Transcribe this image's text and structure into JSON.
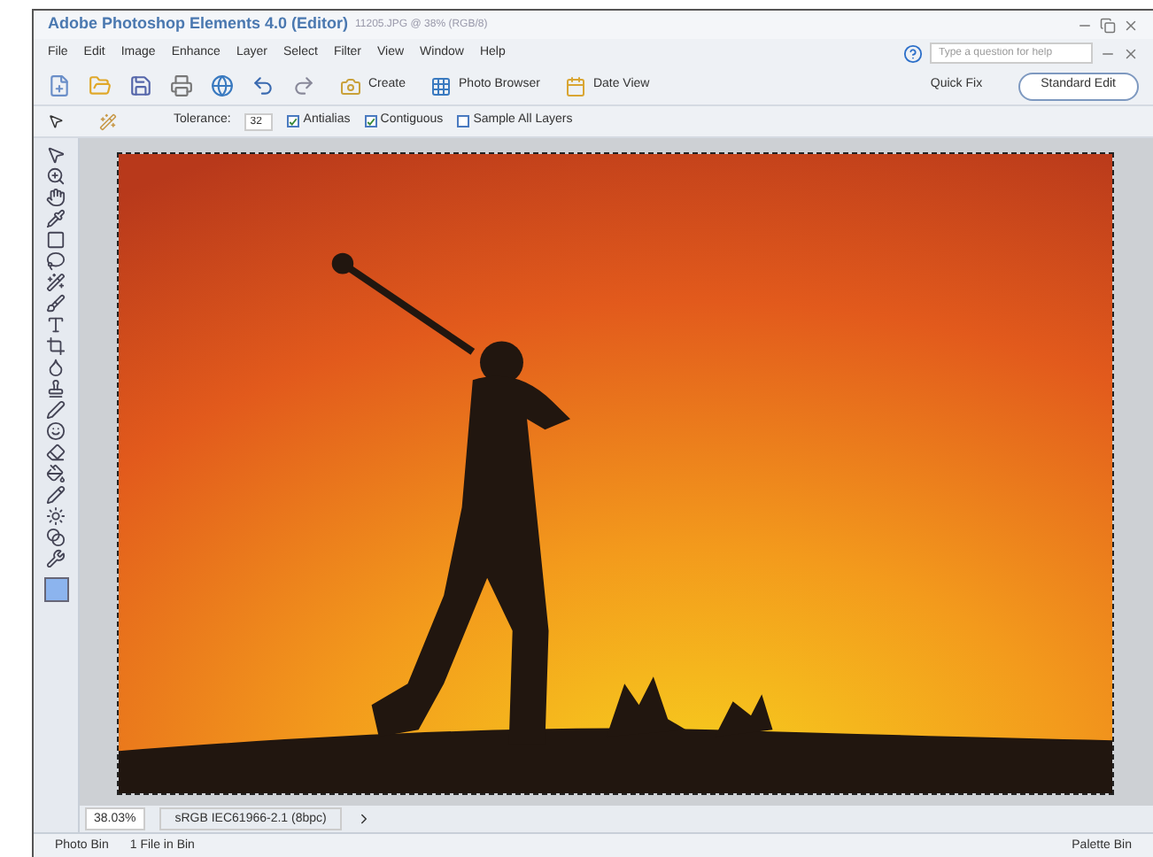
{
  "window": {
    "title": "Adobe Photoshop Elements 4.0 (Editor)",
    "subtitle": "11205.JPG @ 38% (RGB/8)"
  },
  "menu": [
    "File",
    "Edit",
    "Image",
    "Enhance",
    "Layer",
    "Select",
    "Filter",
    "View",
    "Window",
    "Help"
  ],
  "help_search": {
    "placeholder": "Type a question for help"
  },
  "toolbar_buttons": [
    "Create",
    "Photo Browser",
    "Date View"
  ],
  "modes": [
    {
      "label": "Quick Fix",
      "selected": false
    },
    {
      "label": "Standard Edit",
      "selected": true
    }
  ],
  "options": {
    "tolerance_label": "Tolerance:",
    "tolerance": "32",
    "checks": [
      {
        "label": "Antialias",
        "checked": true
      },
      {
        "label": "Contiguous",
        "checked": true
      },
      {
        "label": "Sample All Layers",
        "checked": false
      }
    ]
  },
  "status": {
    "zoom": "38.03%",
    "profile": "sRGB IEC61966-2.1 (8bpc)"
  },
  "bins": {
    "photo_bin": "Photo Bin",
    "file_count": "1 File in Bin",
    "palette_bin": "Palette Bin"
  }
}
